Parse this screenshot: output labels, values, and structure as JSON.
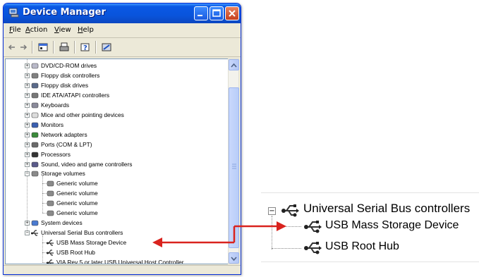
{
  "window": {
    "title": "Device Manager",
    "menu": [
      "File",
      "Action",
      "View",
      "Help"
    ],
    "menu_underline": [
      "F",
      "A",
      "V",
      "H"
    ]
  },
  "tree": {
    "items": [
      {
        "label": "DVD/CD-ROM drives",
        "level": 1,
        "expander": "+",
        "icon": "cdrom-icon"
      },
      {
        "label": "Floppy disk controllers",
        "level": 1,
        "expander": "+",
        "icon": "floppy-controller-icon"
      },
      {
        "label": "Floppy disk drives",
        "level": 1,
        "expander": "+",
        "icon": "floppy-drive-icon"
      },
      {
        "label": "IDE ATA/ATAPI controllers",
        "level": 1,
        "expander": "+",
        "icon": "ide-controller-icon"
      },
      {
        "label": "Keyboards",
        "level": 1,
        "expander": "+",
        "icon": "keyboard-icon"
      },
      {
        "label": "Mice and other pointing devices",
        "level": 1,
        "expander": "+",
        "icon": "mouse-icon"
      },
      {
        "label": "Monitors",
        "level": 1,
        "expander": "+",
        "icon": "monitor-icon"
      },
      {
        "label": "Network adapters",
        "level": 1,
        "expander": "+",
        "icon": "network-adapter-icon"
      },
      {
        "label": "Ports (COM & LPT)",
        "level": 1,
        "expander": "+",
        "icon": "port-icon"
      },
      {
        "label": "Processors",
        "level": 1,
        "expander": "+",
        "icon": "processor-icon"
      },
      {
        "label": "Sound, video and game controllers",
        "level": 1,
        "expander": "+",
        "icon": "sound-icon"
      },
      {
        "label": "Storage volumes",
        "level": 1,
        "expander": "−",
        "icon": "storage-volume-icon"
      },
      {
        "label": "Generic volume",
        "level": 2,
        "expander": "",
        "icon": "storage-volume-icon"
      },
      {
        "label": "Generic volume",
        "level": 2,
        "expander": "",
        "icon": "storage-volume-icon"
      },
      {
        "label": "Generic volume",
        "level": 2,
        "expander": "",
        "icon": "storage-volume-icon"
      },
      {
        "label": "Generic volume",
        "level": 2,
        "expander": "",
        "icon": "storage-volume-icon"
      },
      {
        "label": "System devices",
        "level": 1,
        "expander": "+",
        "icon": "system-device-icon"
      },
      {
        "label": "Universal Serial Bus controllers",
        "level": 1,
        "expander": "−",
        "icon": "usb-icon"
      },
      {
        "label": "USB Mass Storage Device",
        "level": 2,
        "expander": "",
        "icon": "usb-icon"
      },
      {
        "label": "USB Root Hub",
        "level": 2,
        "expander": "",
        "icon": "usb-icon"
      },
      {
        "label": "VIA Rev 5 or later USB Universal Host Controller",
        "level": 2,
        "expander": "",
        "icon": "usb-icon"
      }
    ]
  },
  "zoom": {
    "header": "Universal Serial Bus controllers",
    "children": [
      "USB Mass Storage Device",
      "USB Root Hub"
    ]
  },
  "colors": {
    "arrow": "#d9231e",
    "titlebar": "#0a58e4"
  }
}
